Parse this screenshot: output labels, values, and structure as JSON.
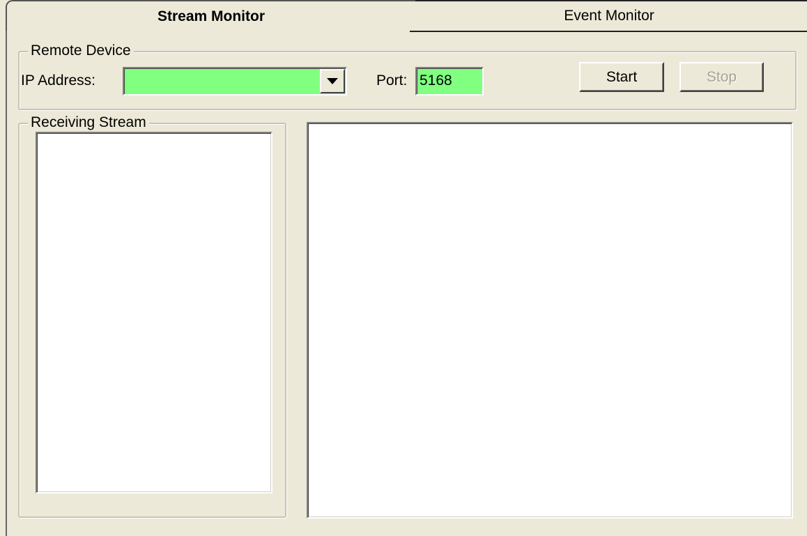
{
  "tabs": [
    {
      "label": "Stream Monitor",
      "active": true
    },
    {
      "label": "Event Monitor",
      "active": false
    }
  ],
  "remote_device": {
    "title": "Remote Device",
    "ip_label": "IP Address:",
    "ip_value": "",
    "port_label": "Port:",
    "port_value": "5168",
    "start_label": "Start",
    "stop_label": "Stop",
    "field_color": "#80ff80"
  },
  "receiving_stream": {
    "title": "Receiving Stream",
    "items": []
  }
}
